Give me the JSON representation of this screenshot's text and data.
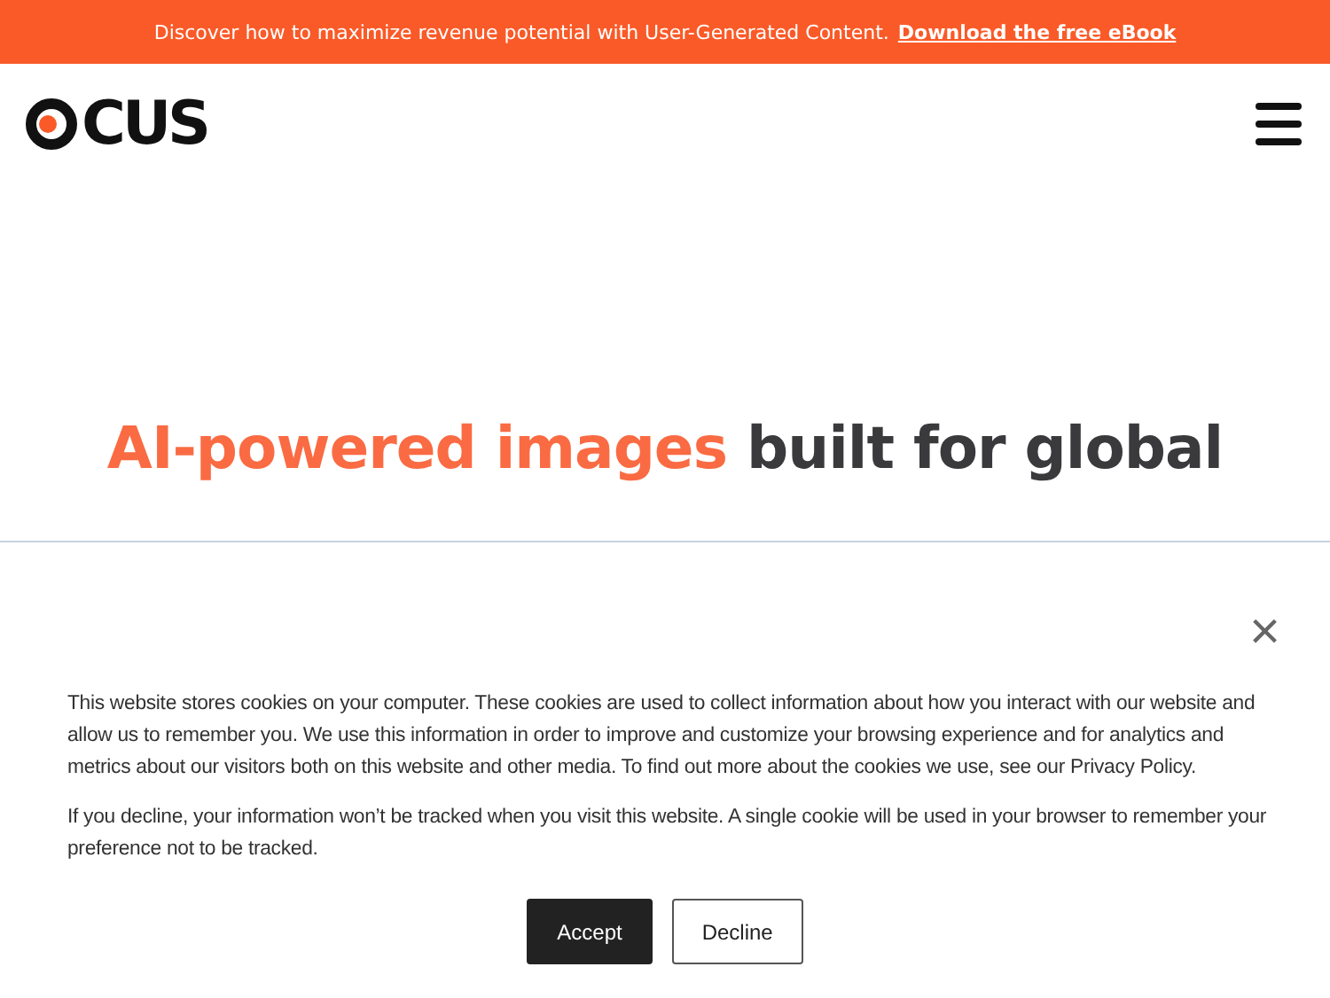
{
  "announcement": {
    "text": "Discover how to maximize revenue potential with User-Generated Content.",
    "link": "Download the free eBook"
  },
  "logo": {
    "text": "CUS"
  },
  "hero": {
    "title_highlight": "AI-powered images",
    "title_rest": "built for global"
  },
  "cookie_banner": {
    "close": "×",
    "paragraphs": [
      "This website stores cookies on your computer. These cookies are used to collect information about how you interact with our website and allow us to remember you. We use this information in order to improve and customize your browsing experience and for analytics and metrics about our visitors both on this website and other media. To find out more about the cookies we use, see our Privacy Policy.",
      "If you decline, your information won’t be tracked when you visit this website. A single cookie will be used in your browser to remember your preference not to be tracked."
    ],
    "buttons": [
      {
        "label": "Accept",
        "kind": "primary"
      },
      {
        "label": "Decline",
        "kind": "secondary"
      }
    ]
  }
}
